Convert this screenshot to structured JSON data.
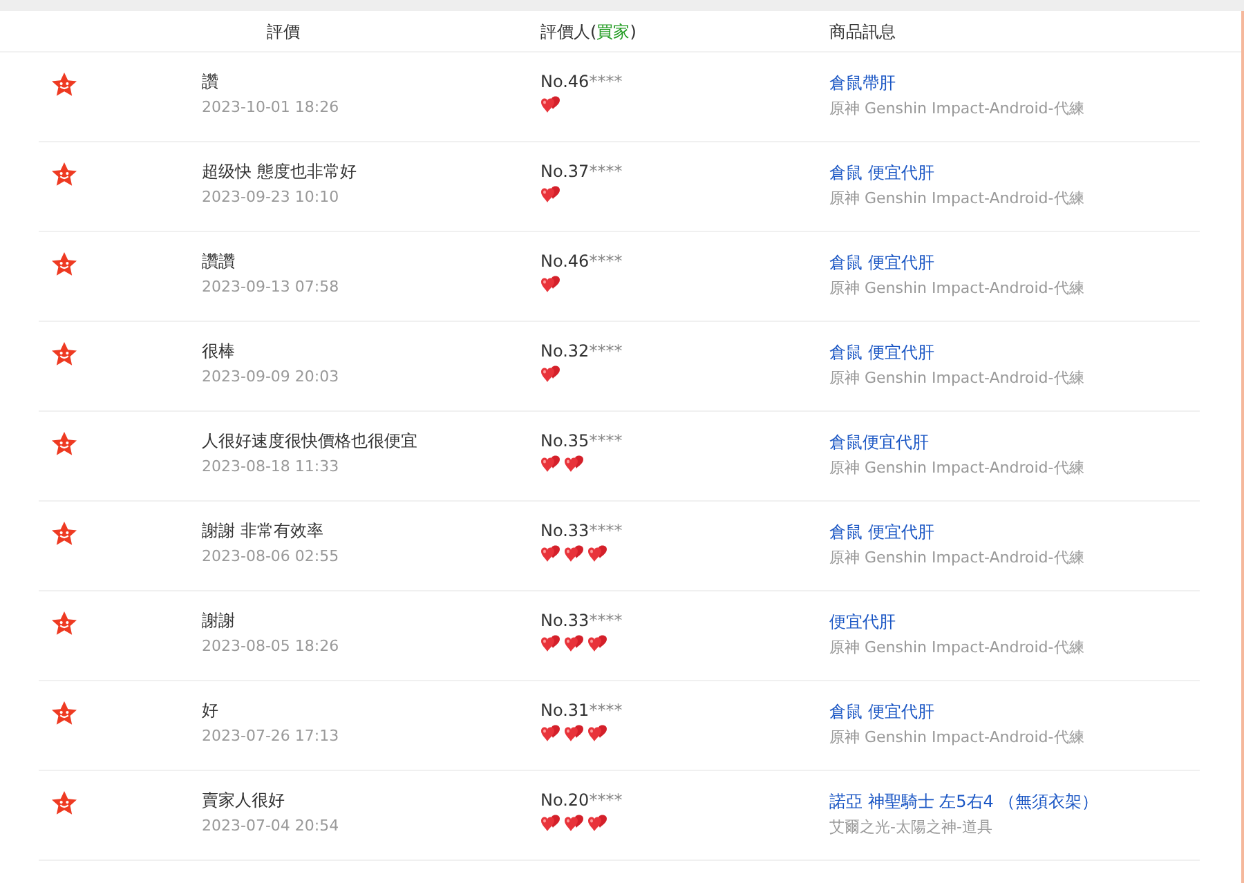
{
  "header": {
    "columns": [
      {
        "label": "評價"
      },
      {
        "label": "評價人(",
        "highlight": "買家",
        "suffix": ")"
      },
      {
        "label": "商品訊息"
      }
    ]
  },
  "reviews": [
    {
      "comment": "讚",
      "time": "2023-10-01 18:26",
      "buyer": "No.46",
      "buyer_mask": "****",
      "rank_icons": [
        {
          "kind": "heart"
        }
      ],
      "product": "倉鼠帶肝",
      "game": "原神 Genshin Impact-Android-代練"
    },
    {
      "comment": "超级快 態度也非常好",
      "time": "2023-09-23 10:10",
      "buyer": "No.37",
      "buyer_mask": "****",
      "rank_icons": [
        {
          "kind": "heart"
        }
      ],
      "product": "倉鼠 便宜代肝",
      "game": "原神 Genshin Impact-Android-代練"
    },
    {
      "comment": "讚讚",
      "time": "2023-09-13 07:58",
      "buyer": "No.46",
      "buyer_mask": "****",
      "rank_icons": [
        {
          "kind": "heart"
        }
      ],
      "product": "倉鼠 便宜代肝",
      "game": "原神 Genshin Impact-Android-代練"
    },
    {
      "comment": "很棒",
      "time": "2023-09-09 20:03",
      "buyer": "No.32",
      "buyer_mask": "****",
      "rank_icons": [
        {
          "kind": "heart"
        }
      ],
      "product": "倉鼠 便宜代肝",
      "game": "原神 Genshin Impact-Android-代練"
    },
    {
      "comment": "人很好速度很快價格也很便宜",
      "time": "2023-08-18 11:33",
      "buyer": "No.35",
      "buyer_mask": "****",
      "rank_icons": [
        {
          "kind": "heart"
        },
        {
          "kind": "heart"
        }
      ],
      "product": "倉鼠便宜代肝",
      "game": "原神 Genshin Impact-Android-代練"
    },
    {
      "comment": "謝謝 非常有效率",
      "time": "2023-08-06 02:55",
      "buyer": "No.33",
      "buyer_mask": "****",
      "rank_icons": [
        {
          "kind": "heart"
        },
        {
          "kind": "heart"
        },
        {
          "kind": "heart"
        }
      ],
      "product": "倉鼠 便宜代肝",
      "game": "原神 Genshin Impact-Android-代練"
    },
    {
      "comment": "謝謝",
      "time": "2023-08-05 18:26",
      "buyer": "No.33",
      "buyer_mask": "****",
      "rank_icons": [
        {
          "kind": "heart"
        },
        {
          "kind": "heart"
        },
        {
          "kind": "heart"
        }
      ],
      "product": "便宜代肝",
      "game": "原神 Genshin Impact-Android-代練"
    },
    {
      "comment": "好",
      "time": "2023-07-26 17:13",
      "buyer": "No.31",
      "buyer_mask": "****",
      "rank_icons": [
        {
          "kind": "heart"
        },
        {
          "kind": "heart"
        },
        {
          "kind": "heart"
        }
      ],
      "product": "倉鼠 便宜代肝",
      "game": "原神 Genshin Impact-Android-代練"
    },
    {
      "comment": "賣家人很好",
      "time": "2023-07-04 20:54",
      "buyer": "No.20",
      "buyer_mask": "****",
      "rank_icons": [
        {
          "kind": "heart"
        },
        {
          "kind": "heart"
        },
        {
          "kind": "heart"
        }
      ],
      "product": "諾亞 神聖騎士 左5右4 （無須衣架）",
      "game": "艾爾之光-太陽之神-道具"
    }
  ]
}
